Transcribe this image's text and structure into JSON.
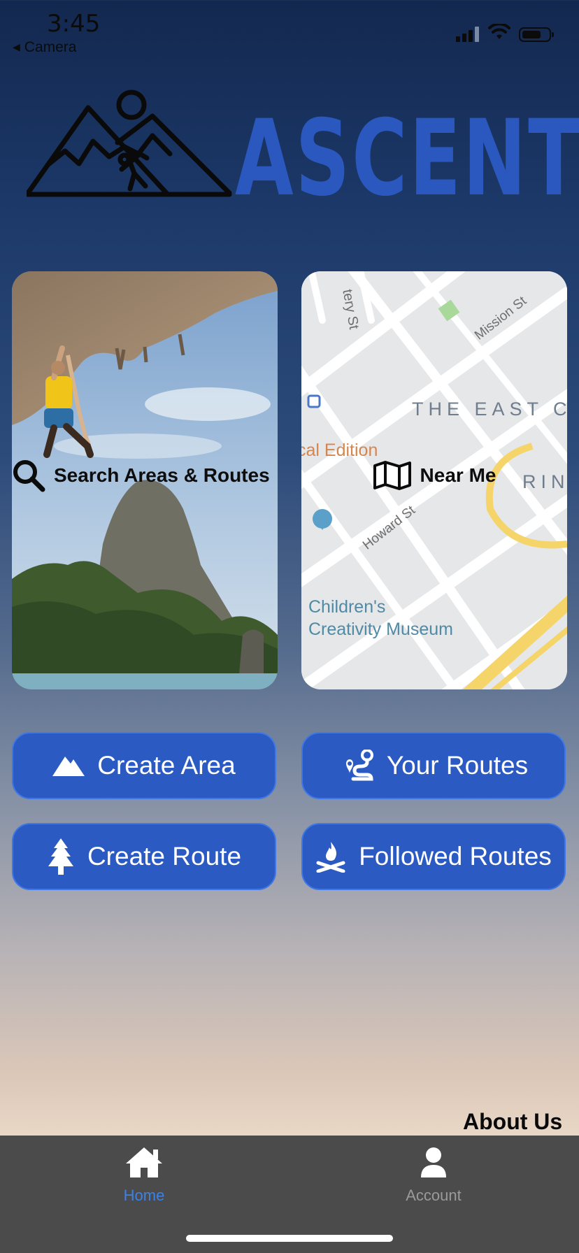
{
  "status_bar": {
    "time": "3:45",
    "back_label": "Camera"
  },
  "app": {
    "name": "ASCENT"
  },
  "cards": {
    "search": {
      "label": "Search Areas & Routes",
      "icon": "search-icon"
    },
    "near_me": {
      "label": "Near Me",
      "icon": "map-icon",
      "map_labels": {
        "street_1": "tery St",
        "street_2": "Mission St",
        "district": "THE EAST C",
        "place_1": "cal Edition",
        "street_3": "Howard St",
        "partial": "RIN",
        "museum_line1": "Children's",
        "museum_line2": "Creativity Museum"
      }
    }
  },
  "actions": [
    {
      "label": "Create Area",
      "icon": "mountain-icon"
    },
    {
      "label": "Your Routes",
      "icon": "route-icon"
    },
    {
      "label": "Create Route",
      "icon": "tree-icon"
    },
    {
      "label": "Followed Routes",
      "icon": "campfire-icon"
    }
  ],
  "about_link": "About Us",
  "tabs": [
    {
      "label": "Home",
      "icon": "home-icon",
      "active": true
    },
    {
      "label": "Account",
      "icon": "user-icon",
      "active": false
    }
  ],
  "colors": {
    "primary": "#2b5ac2",
    "tab_active": "#3b82e6",
    "tab_inactive": "#9a9a9a",
    "tab_bg": "#4b4b4b"
  }
}
